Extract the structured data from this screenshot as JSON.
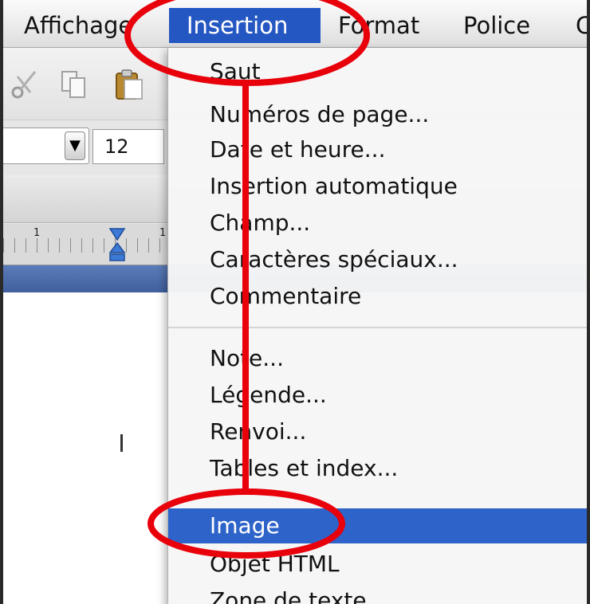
{
  "menubar": {
    "items": [
      "Affichage",
      "Insertion",
      "Format",
      "Police",
      "C"
    ]
  },
  "toolbar": {
    "font_size": "12"
  },
  "ruler": {
    "labels": [
      "1",
      "1"
    ]
  },
  "insertion_menu": {
    "items": [
      "Saut",
      "Numéros de page...",
      "Date et heure...",
      "Insertion automatique",
      "Champ...",
      "Caractères spéciaux...",
      "Commentaire",
      "Note...",
      "Légende...",
      "Renvoi...",
      "Tables et index...",
      "Image",
      "Objet HTML",
      "Zone de texte"
    ],
    "highlighted": "Image",
    "highlight_color": "#2e63c9"
  },
  "annotation": {
    "color": "#e8000b"
  }
}
